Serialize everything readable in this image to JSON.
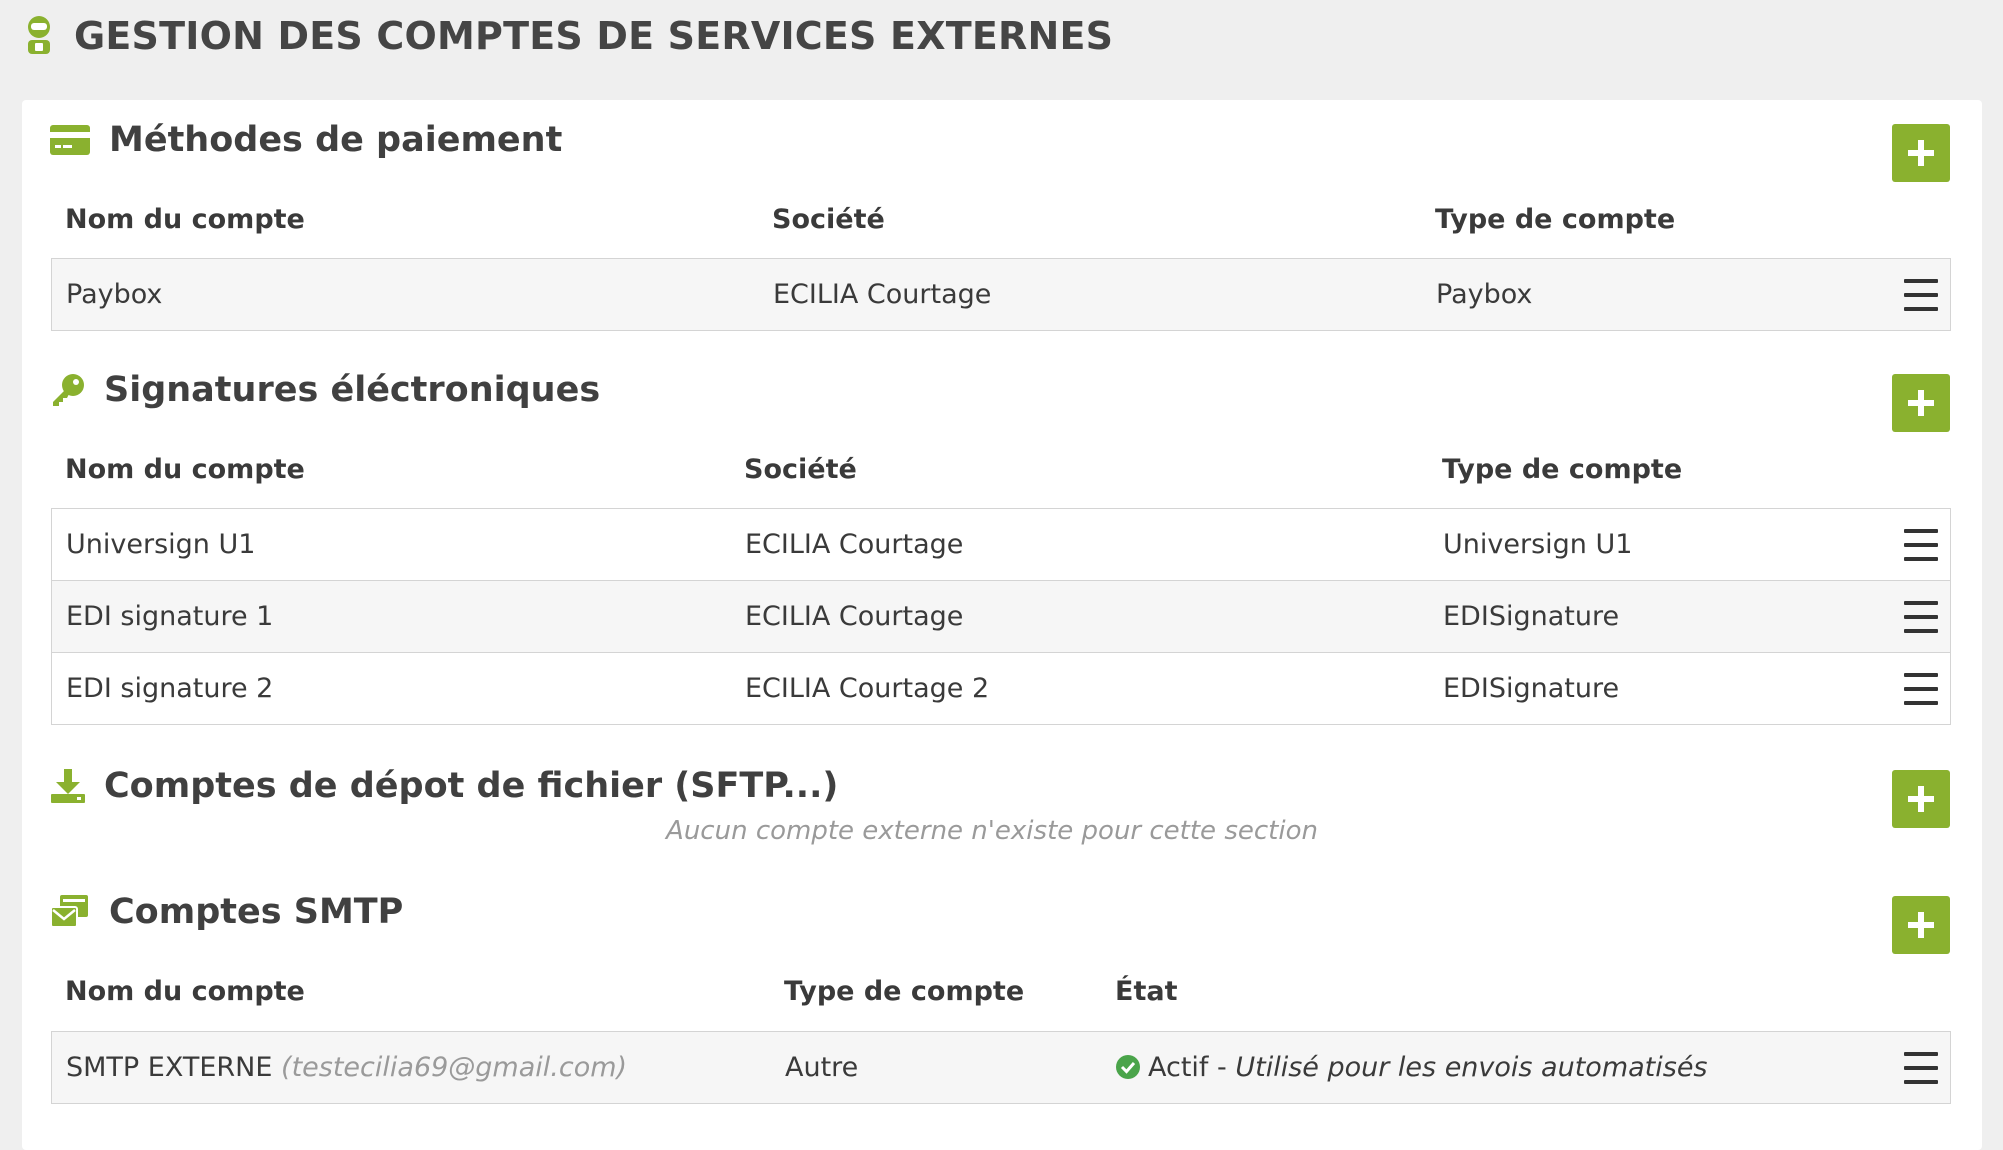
{
  "header": {
    "title": "GESTION DES COMPTES DE SERVICES EXTERNES",
    "icon": "user-gear-icon"
  },
  "colors": {
    "accent": "#8ab12f",
    "success": "#4aa44a"
  },
  "payment": {
    "title": "Méthodes de paiement",
    "icon": "credit-card-icon",
    "columns": [
      "Nom du compte",
      "Société",
      "Type de compte"
    ],
    "rows": [
      {
        "name": "Paybox",
        "company": "ECILIA Courtage",
        "type": "Paybox"
      }
    ]
  },
  "signatures": {
    "title": "Signatures éléctroniques",
    "icon": "key-icon",
    "columns": [
      "Nom du compte",
      "Société",
      "Type de compte"
    ],
    "rows": [
      {
        "name": "Universign U1",
        "company": "ECILIA Courtage",
        "type": "Universign U1"
      },
      {
        "name": "EDI signature 1",
        "company": "ECILIA Courtage",
        "type": "EDISignature"
      },
      {
        "name": "EDI signature 2",
        "company": "ECILIA Courtage 2",
        "type": "EDISignature"
      }
    ]
  },
  "sftp": {
    "title": "Comptes de dépot de fichier (SFTP...)",
    "icon": "download-icon",
    "empty_text": "Aucun compte externe n'existe pour cette section"
  },
  "smtp": {
    "title": "Comptes SMTP",
    "icon": "mail-server-icon",
    "columns": [
      "Nom du compte",
      "Type de compte",
      "État"
    ],
    "rows": [
      {
        "name": "SMTP EXTERNE",
        "email": "(testecilia69@gmail.com)",
        "type": "Autre",
        "status": "Actif",
        "status_sep": " - ",
        "status_note": "Utilisé pour les envois automatisés"
      }
    ]
  }
}
